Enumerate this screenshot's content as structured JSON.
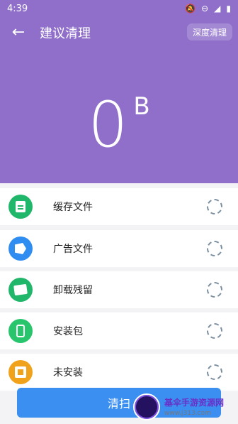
{
  "status": {
    "time": "4:39",
    "icons": [
      "mute-icon",
      "dnd-icon",
      "signal-icon",
      "battery-icon"
    ]
  },
  "appbar": {
    "back_icon": "arrow-left-icon",
    "title": "建议清理",
    "deep_clean": "深度清理"
  },
  "summary": {
    "value": "0",
    "unit": "B"
  },
  "items": [
    {
      "label": "缓存文件",
      "icon": "cache-icon",
      "color": "#21b76b"
    },
    {
      "label": "广告文件",
      "icon": "ad-icon",
      "color": "#2f8cf0"
    },
    {
      "label": "卸载残留",
      "icon": "uninstall-icon",
      "color": "#21b76b"
    },
    {
      "label": "安装包",
      "icon": "apk-icon",
      "color": "#29c56d"
    },
    {
      "label": "未安装",
      "icon": "not-installed-icon",
      "color": "#f0a21b"
    }
  ],
  "action": {
    "clean": "清扫"
  },
  "watermark": {
    "title": "基伞手游资源网",
    "url": "www.j313.com"
  }
}
